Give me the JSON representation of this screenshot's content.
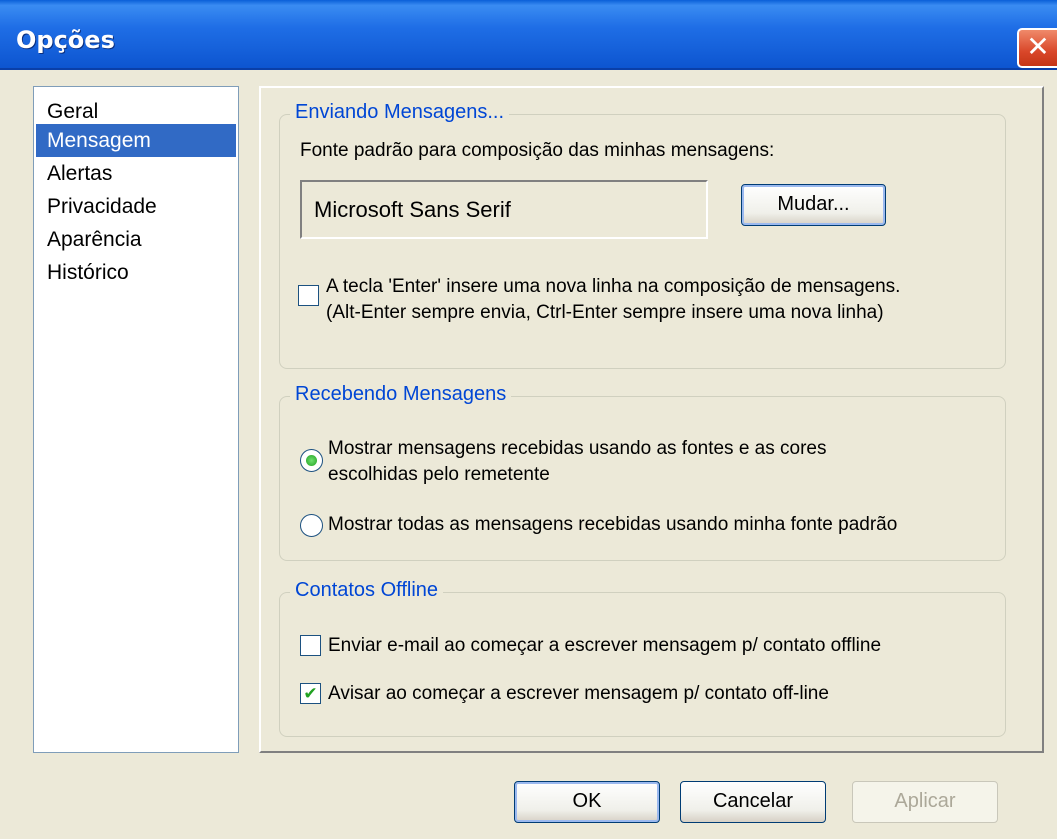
{
  "window": {
    "title": "Opções",
    "close_glyph": "✕"
  },
  "nav": {
    "items": [
      {
        "label": "Geral"
      },
      {
        "label": "Mensagem",
        "selected": true
      },
      {
        "label": "Alertas"
      },
      {
        "label": "Privacidade"
      },
      {
        "label": "Aparência"
      },
      {
        "label": "Histórico"
      }
    ]
  },
  "sending": {
    "legend": "Enviando Mensagens...",
    "font_label": "Fonte padrão para composição das minhas mensagens:",
    "font_value": "Microsoft Sans Serif",
    "change_button": "Mudar...",
    "enter_checkbox_line1": "A tecla 'Enter' insere uma nova linha na composição de mensagens.",
    "enter_checkbox_line2": "(Alt-Enter sempre envia, Ctrl-Enter sempre insere uma nova linha)",
    "enter_checked": false
  },
  "receiving": {
    "legend": "Recebendo Mensagens",
    "option1_line1": "Mostrar mensagens recebidas usando as fontes e as cores",
    "option1_line2": "escolhidas pelo remetente",
    "option2": "Mostrar todas as mensagens recebidas usando minha fonte padrão",
    "selected_option": 1
  },
  "offline": {
    "legend": "Contatos Offline",
    "email_checkbox": "Enviar e-mail ao começar a escrever mensagem p/ contato offline",
    "email_checked": false,
    "warn_checkbox": "Avisar ao começar a escrever mensagem p/ contato off-line",
    "warn_checked": true,
    "check_glyph": "✔"
  },
  "buttons": {
    "ok": "OK",
    "cancel": "Cancelar",
    "apply": "Aplicar"
  }
}
